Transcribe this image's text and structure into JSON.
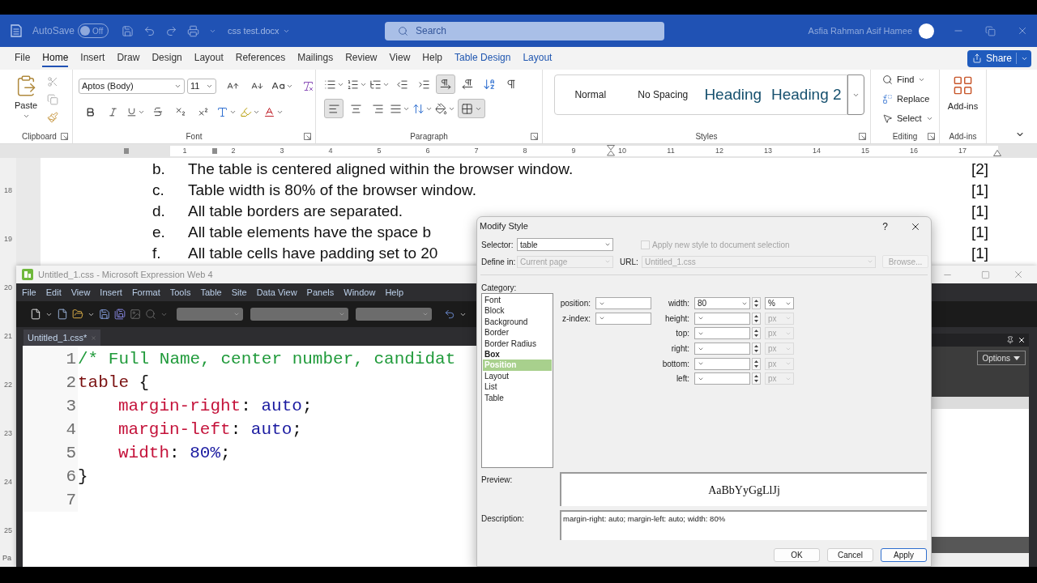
{
  "word": {
    "title_bar": {
      "autosave_label": "AutoSave",
      "autosave_toggle": {
        "label": "Off",
        "on": false
      },
      "document_name": "css test.docx",
      "search": {
        "placeholder": "Search"
      },
      "user_name": "Asfia Rahman Asif Hamee"
    },
    "ribbon_tabs": [
      {
        "label": "File",
        "selected": false,
        "contextual": false
      },
      {
        "label": "Home",
        "selected": true,
        "contextual": false
      },
      {
        "label": "Insert",
        "selected": false,
        "contextual": false
      },
      {
        "label": "Draw",
        "selected": false,
        "contextual": false
      },
      {
        "label": "Design",
        "selected": false,
        "contextual": false
      },
      {
        "label": "Layout",
        "selected": false,
        "contextual": false
      },
      {
        "label": "References",
        "selected": false,
        "contextual": false
      },
      {
        "label": "Mailings",
        "selected": false,
        "contextual": false
      },
      {
        "label": "Review",
        "selected": false,
        "contextual": false
      },
      {
        "label": "View",
        "selected": false,
        "contextual": false
      },
      {
        "label": "Help",
        "selected": false,
        "contextual": false
      },
      {
        "label": "Table Design",
        "selected": false,
        "contextual": true
      },
      {
        "label": "Layout",
        "selected": false,
        "contextual": true
      }
    ],
    "share_button": {
      "label": "Share"
    },
    "ribbon": {
      "clipboard": {
        "paste_label": "Paste",
        "group_label": "Clipboard"
      },
      "font": {
        "font_name": "Aptos (Body)",
        "font_size": "11",
        "group_label": "Font"
      },
      "paragraph": {
        "left_to_right_pressed": true,
        "align_left_pressed": true,
        "borders_pressed": true,
        "group_label": "Paragraph"
      },
      "styles": {
        "items": [
          {
            "label": "Normal",
            "kind": "body"
          },
          {
            "label": "No Spacing",
            "kind": "body"
          },
          {
            "label": "Heading",
            "kind": "heading"
          },
          {
            "label": "Heading 2",
            "kind": "heading"
          }
        ],
        "group_label": "Styles"
      },
      "editing": {
        "find": "Find",
        "replace": "Replace",
        "select": "Select",
        "group_label": "Editing"
      },
      "add_ins": {
        "button_label": "Add-ins",
        "group_label": "Add-ins"
      }
    },
    "ruler": {
      "numbers": [
        "1",
        "2",
        "3",
        "4",
        "5",
        "6",
        "7",
        "8",
        "9",
        "10",
        "11",
        "12",
        "13",
        "14",
        "15",
        "16",
        "17"
      ]
    },
    "vertical_ruler": {
      "numbers": [
        "18",
        "19",
        "20",
        "21",
        "22",
        "23",
        "24",
        "25"
      ]
    },
    "document": {
      "items": [
        {
          "marker": "b.",
          "text": "The table is centered aligned within the browser window.",
          "marks": "[2]"
        },
        {
          "marker": "c.",
          "text": "Table width is 80% of the browser window.",
          "marks": "[1]"
        },
        {
          "marker": "d.",
          "text": "All table borders are separated.",
          "marks": "[1]"
        },
        {
          "marker": "e.",
          "text": "All table elements have the space b",
          "marks": "[1]"
        },
        {
          "marker": "f.",
          "text": "All table cells have padding set to 20",
          "marks": "[1]"
        }
      ]
    },
    "status_bar": {
      "text": "Pa"
    }
  },
  "expression_web": {
    "title": "Untitled_1.css - Microsoft Expression Web 4",
    "menu": [
      "File",
      "Edit",
      "View",
      "Insert",
      "Format",
      "Tools",
      "Table",
      "Site",
      "Data View",
      "Panels",
      "Window",
      "Help"
    ],
    "document_tabs": [
      {
        "label": "Untitled_1.css*",
        "selected": true
      }
    ],
    "code_lines": [
      {
        "number": "1",
        "tokens": [
          {
            "kind": "comment",
            "text": "/* Full Name, center number, candidat"
          }
        ]
      },
      {
        "number": "2",
        "tokens": [
          {
            "kind": "selector",
            "text": "table"
          },
          {
            "kind": "punctuation",
            "text": " {"
          }
        ],
        "children": [
          {
            "number": "3",
            "tokens": [
              {
                "kind": "property",
                "text": "margin-right"
              },
              {
                "kind": "punctuation",
                "text": ": "
              },
              {
                "kind": "value",
                "text": "auto"
              },
              {
                "kind": "punctuation",
                "text": ";"
              }
            ]
          },
          {
            "number": "4",
            "tokens": [
              {
                "kind": "property",
                "text": "margin-left"
              },
              {
                "kind": "punctuation",
                "text": ": "
              },
              {
                "kind": "value",
                "text": "auto"
              },
              {
                "kind": "punctuation",
                "text": ";"
              }
            ]
          },
          {
            "number": "5",
            "tokens": [
              {
                "kind": "property",
                "text": "width"
              },
              {
                "kind": "punctuation",
                "text": ": "
              },
              {
                "kind": "value",
                "text": "80%"
              },
              {
                "kind": "punctuation",
                "text": ";"
              }
            ]
          }
        ]
      },
      {
        "number": "6",
        "tokens": [
          {
            "kind": "punctuation",
            "text": "}"
          }
        ]
      },
      {
        "number": "7"
      }
    ],
    "panel": {
      "options_button": "Options"
    }
  },
  "modify_style": {
    "title": "Modify Style",
    "help_button": "?",
    "selector": {
      "label": "Selector:",
      "value": "table"
    },
    "apply_checkbox": {
      "label": "Apply new style to document selection",
      "checked": false,
      "disabled": true
    },
    "define_in": {
      "label": "Define in:",
      "value": "Current page",
      "disabled": true
    },
    "url": {
      "label": "URL:",
      "value": "Untitled_1.css",
      "disabled": true
    },
    "browse_button": {
      "label": "Browse...",
      "disabled": true
    },
    "category": {
      "label": "Category:",
      "items": [
        {
          "label": "Font",
          "selected": false,
          "modified": false
        },
        {
          "label": "Block",
          "selected": false,
          "modified": false
        },
        {
          "label": "Background",
          "selected": false,
          "modified": false
        },
        {
          "label": "Border",
          "selected": false,
          "modified": false
        },
        {
          "label": "Border Radius",
          "selected": false,
          "modified": false
        },
        {
          "label": "Box",
          "selected": false,
          "modified": true
        },
        {
          "label": "Position",
          "selected": true,
          "modified": true
        },
        {
          "label": "Layout",
          "selected": false,
          "modified": false
        },
        {
          "label": "List",
          "selected": false,
          "modified": false
        },
        {
          "label": "Table",
          "selected": false,
          "modified": false
        }
      ]
    },
    "position_fields": [
      {
        "label": "position:"
      },
      {
        "label": "z-index:"
      }
    ],
    "size_fields": [
      {
        "label": "width:",
        "value": "80",
        "unit": "%",
        "unit_disabled": false
      },
      {
        "label": "height:",
        "unit": "px",
        "unit_disabled": true
      },
      {
        "label": "top:",
        "unit": "px",
        "unit_disabled": true
      },
      {
        "label": "right:",
        "unit": "px",
        "unit_disabled": true
      },
      {
        "label": "bottom:",
        "unit": "px",
        "unit_disabled": true
      },
      {
        "label": "left:",
        "unit": "px",
        "unit_disabled": true
      }
    ],
    "preview": {
      "label": "Preview:",
      "sample": "AaBbYyGgLlJj"
    },
    "description": {
      "label": "Description:",
      "text": "margin-right: auto; margin-left: auto; width: 80%"
    },
    "buttons": [
      {
        "label": "OK",
        "default": false
      },
      {
        "label": "Cancel",
        "default": false
      },
      {
        "label": "Apply",
        "default": true
      }
    ]
  }
}
